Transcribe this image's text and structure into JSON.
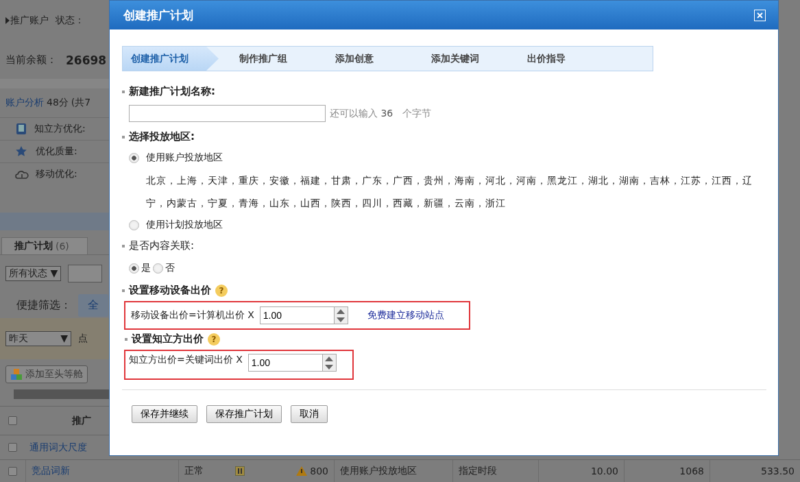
{
  "background": {
    "account": {
      "label": "推广账户",
      "status_label": "状态："
    },
    "balance": {
      "label": "当前余额：",
      "value": "26698"
    },
    "analysis": {
      "link": "账户分析",
      "score": "48分",
      "count": "(共7"
    },
    "metrics": [
      {
        "kind": "book",
        "label": "知立方优化:"
      },
      {
        "kind": "star",
        "label": "优化质量:"
      },
      {
        "kind": "cloud",
        "label": "移动优化:"
      }
    ],
    "tab": {
      "label": "推广计划",
      "count": "(6)"
    },
    "status_select": "所有状态 ▼",
    "quick_filter": {
      "label": "便捷筛选：",
      "button": "全"
    },
    "date_select": {
      "value": "昨天",
      "caret": "▼",
      "next": "点"
    },
    "add_button": "添加至头等舱",
    "table": {
      "header": "推广",
      "header_checked": false,
      "rows": [
        {
          "name": "通用词大尺度",
          "checked": false
        },
        {
          "name": "竞品词新",
          "checked": false,
          "status": "正常",
          "warning": "800",
          "region": "使用账户投放地区",
          "schedule": "指定时段",
          "bid": "10.00",
          "clicks": "1068",
          "cost": "533.50"
        }
      ]
    }
  },
  "dialog": {
    "title": "创建推广计划",
    "steps": [
      {
        "label": "创建推广计划",
        "selected": true
      },
      {
        "label": "制作推广组",
        "selected": false
      },
      {
        "label": "添加创意",
        "selected": false
      },
      {
        "label": "添加关键词",
        "selected": false
      },
      {
        "label": "出价指导",
        "selected": false
      }
    ],
    "name_field": {
      "label": "新建推广计划名称:",
      "hint_prefix": "还可以输入",
      "remaining": "36",
      "hint_suffix": "个字节"
    },
    "region": {
      "label": "选择投放地区:",
      "options": [
        {
          "label": "使用账户投放地区",
          "selected": true,
          "regions": "北京，上海，天津，重庆，安徽，福建，甘肃，广东，广西，贵州，海南，河北，河南，黑龙江，湖北，湖南，吉林，江苏，江西，辽宁，内蒙古，宁夏，青海，山东，山西，陕西，四川，西藏，新疆，云南，浙江"
        },
        {
          "label": "使用计划投放地区",
          "selected": false
        }
      ]
    },
    "content_relation": {
      "label": "是否内容关联:",
      "options": [
        {
          "label": "是",
          "selected": true
        },
        {
          "label": "否",
          "selected": false
        }
      ]
    },
    "bids": [
      {
        "title": "设置移动设备出价",
        "help": "?",
        "formula": "移动设备出价=计算机出价 X",
        "value": "1.00",
        "link": "免费建立移动站点"
      },
      {
        "title": "设置知立方出价",
        "help": "?",
        "formula": "知立方出价=关键词出价 X",
        "value": "1.00"
      }
    ],
    "buttons": [
      "保存并继续",
      "保存推广计划",
      "取消"
    ]
  }
}
